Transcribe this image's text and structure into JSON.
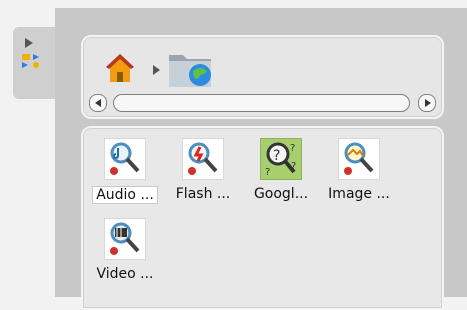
{
  "breadcrumb": {
    "home_icon": "home-icon",
    "separator_icon": "chevron-right-icon",
    "folder_icon": "globe-folder-icon"
  },
  "files": [
    {
      "label": "Audio ...",
      "icon": "audio-search-icon",
      "selected": true
    },
    {
      "label": "Flash ...",
      "icon": "flash-search-icon",
      "selected": false
    },
    {
      "label": "Googl...",
      "icon": "google-search-icon",
      "selected": false
    },
    {
      "label": "Image ...",
      "icon": "image-search-icon",
      "selected": false
    },
    {
      "label": "Video ...",
      "icon": "video-search-icon",
      "selected": false
    }
  ],
  "colors": {
    "page_bg": "#c8c8c8",
    "panel_bg": "#e8e8e8",
    "google_icon_bg": "#a7cf6d"
  }
}
